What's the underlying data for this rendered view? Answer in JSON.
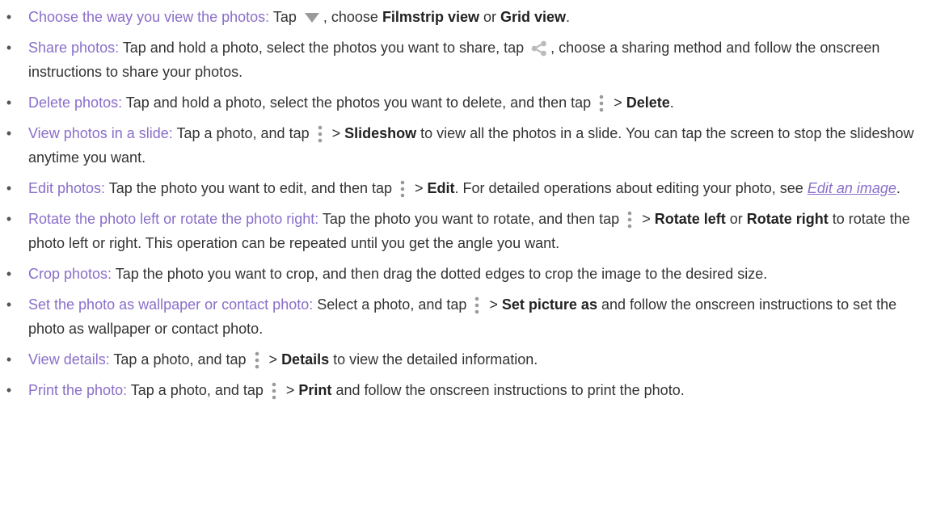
{
  "items": [
    {
      "lead": "Choose the way you view the photos:",
      "t1": " Tap ",
      "t2": ", choose ",
      "b1": "Filmstrip view",
      "t3": " or ",
      "b2": "Grid view",
      "t4": "."
    },
    {
      "lead": "Share photos:",
      "t1": " Tap and hold a photo, select the photos you want to share, tap ",
      "t2": ", choose a sharing method and follow the onscreen instructions to share your photos."
    },
    {
      "lead": "Delete photos:",
      "t1": " Tap and hold a photo, select the photos you want to delete, and then tap ",
      "t2": " > ",
      "b1": "Delete",
      "t3": "."
    },
    {
      "lead": "View photos in a slide:",
      "t1": " Tap a photo, and tap ",
      "t2": " > ",
      "b1": "Slideshow",
      "t3": " to view all the photos in a slide. You can tap the screen to stop the slideshow anytime you want."
    },
    {
      "lead": "Edit photos:",
      "t1": " Tap the photo you want to edit, and then tap ",
      "t2": " > ",
      "b1": "Edit",
      "t3": ". For detailed operations about editing your photo, see ",
      "link": "Edit an image",
      "t4": "."
    },
    {
      "lead": "Rotate the photo left or rotate the photo right:",
      "t1": " Tap the photo you want to rotate, and then tap ",
      "t2": " > ",
      "b1": "Rotate left",
      "t3": " or ",
      "b2": "Rotate right",
      "t4": " to rotate the photo left or right. This operation can be repeated until you get the angle you want."
    },
    {
      "lead": "Crop photos:",
      "t1": " Tap the photo you want to crop, and then drag the dotted edges to crop the image to the desired size."
    },
    {
      "lead": "Set the photo as wallpaper or contact photo:",
      "t1": " Select a photo, and tap ",
      "t2": " > ",
      "b1": "Set picture as",
      "t3": " and follow the onscreen instructions to set the photo as wallpaper or contact photo."
    },
    {
      "lead": "View details:",
      "t1": " Tap a photo, and tap ",
      "t2": " > ",
      "b1": "Details",
      "t3": " to view the detailed information."
    },
    {
      "lead": "Print the photo:",
      "t1": " Tap a photo, and tap ",
      "t2": " > ",
      "b1": "Print",
      "t3": " and follow the onscreen instructions to print the photo."
    }
  ],
  "bullet": "•",
  "icons": {
    "dropdown": "triangle-down-icon",
    "share": "share-icon",
    "menu": "more-vert-icon"
  },
  "colors": {
    "lead": "#8a6ec9",
    "text": "#333333",
    "icon": "#9a9a9a",
    "share": "#bbbbbb"
  }
}
